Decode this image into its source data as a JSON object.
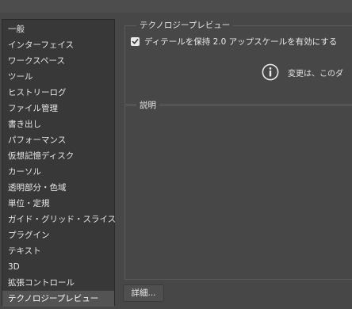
{
  "sidebar": {
    "items": [
      {
        "label": "一般",
        "selected": false
      },
      {
        "label": "インターフェイス",
        "selected": false
      },
      {
        "label": "ワークスペース",
        "selected": false
      },
      {
        "label": "ツール",
        "selected": false
      },
      {
        "label": "ヒストリーログ",
        "selected": false
      },
      {
        "label": "ファイル管理",
        "selected": false
      },
      {
        "label": "書き出し",
        "selected": false
      },
      {
        "label": "パフォーマンス",
        "selected": false
      },
      {
        "label": "仮想記憶ディスク",
        "selected": false
      },
      {
        "label": "カーソル",
        "selected": false
      },
      {
        "label": "透明部分・色域",
        "selected": false
      },
      {
        "label": "単位・定規",
        "selected": false
      },
      {
        "label": "ガイド・グリッド・スライス",
        "selected": false
      },
      {
        "label": "プラグイン",
        "selected": false
      },
      {
        "label": "テキスト",
        "selected": false
      },
      {
        "label": "3D",
        "selected": false
      },
      {
        "label": "拡張コントロール",
        "selected": false
      },
      {
        "label": "テクノロジープレビュー",
        "selected": true
      }
    ]
  },
  "preview_group": {
    "title": "テクノロジープレビュー",
    "checkbox_label": "ディテールを保持 2.0 アップスケールを有効にする",
    "checkbox_checked": true,
    "info_text": "変更は、このダ"
  },
  "description_group": {
    "title": "説明"
  },
  "buttons": {
    "details_label": "詳細..."
  },
  "icons": {
    "checkmark": "checkmark-icon",
    "info": "info-icon"
  },
  "colors": {
    "dialog_bg": "#474747",
    "sidebar_bg": "#383838",
    "selected_bg": "#535353"
  }
}
